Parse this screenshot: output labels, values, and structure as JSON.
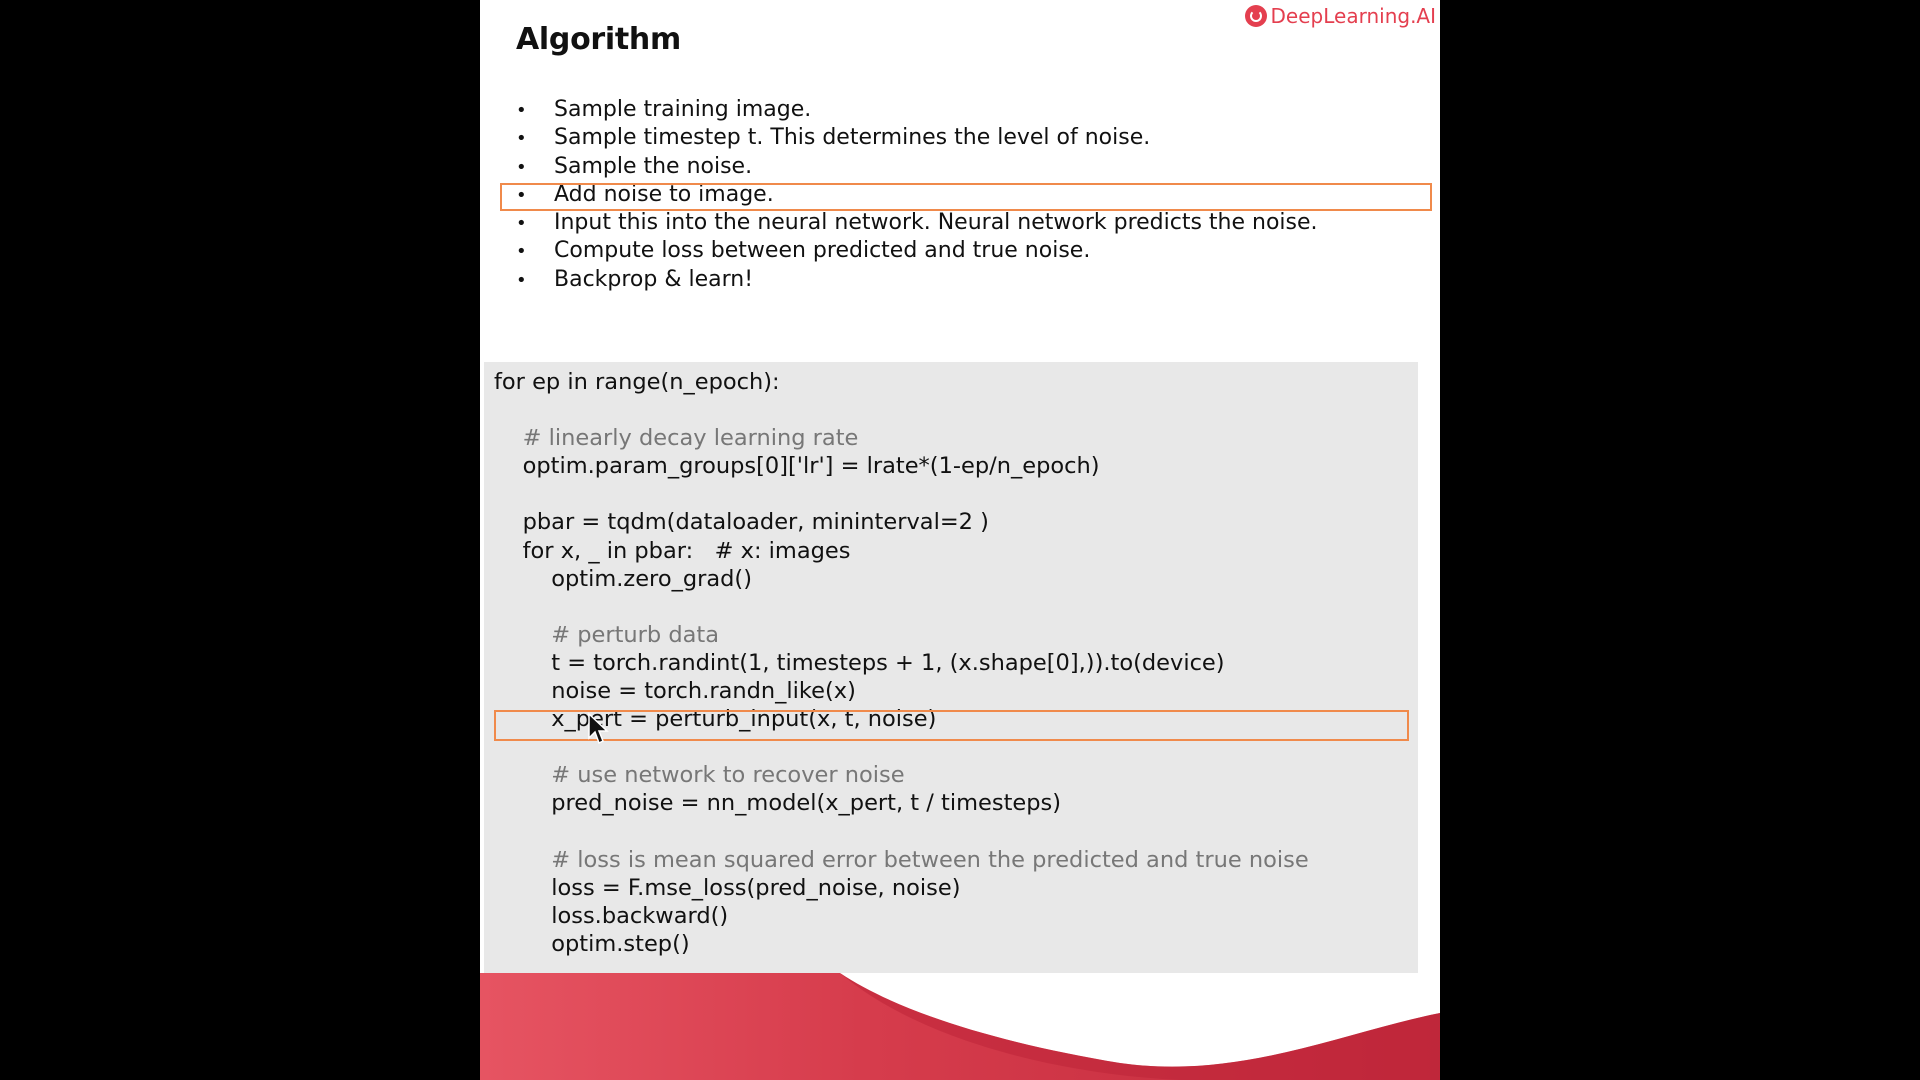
{
  "brand": {
    "name_part1": "DeepLearning",
    "name_part2": ".AI",
    "icon": "deeplearning-logo-icon",
    "color": "#e43f4f"
  },
  "slide": {
    "title": "Algorithm",
    "bullets": [
      "Sample training image.",
      "Sample timestep t. This determines the level of noise.",
      "Sample the noise.",
      "Add noise to image.",
      "Input this into the neural network. Neural network predicts the noise.",
      "Compute loss between predicted and true noise.",
      "Backprop & learn!"
    ],
    "highlighted_bullet": "Add noise to image."
  },
  "code": {
    "lines": [
      "for ep in range(n_epoch):",
      "",
      "    # linearly decay learning rate",
      "    optim.param_groups[0]['lr'] = lrate*(1-ep/n_epoch)",
      "",
      "    pbar = tqdm(dataloader, mininterval=2 )",
      "    for x, _ in pbar:   # x: images",
      "        optim.zero_grad()",
      "",
      "        # perturb data",
      "        t = torch.randint(1, timesteps + 1, (x.shape[0],)).to(device)",
      "        noise = torch.randn_like(x)",
      "        x_pert = perturb_input(x, t, noise)",
      "",
      "        # use network to recover noise",
      "        pred_noise = nn_model(x_pert, t / timesteps)",
      "",
      "        # loss is mean squared error between the predicted and true noise",
      "        loss = F.mse_loss(pred_noise, noise)",
      "        loss.backward()",
      "        optim.step()"
    ],
    "highlighted_line": "x_pert = perturb_input(x, t, noise)"
  },
  "colors": {
    "highlight": "#f08a4b",
    "code_background": "#e8e8e8",
    "footer": "#c22a3c",
    "comment": "#777777"
  }
}
